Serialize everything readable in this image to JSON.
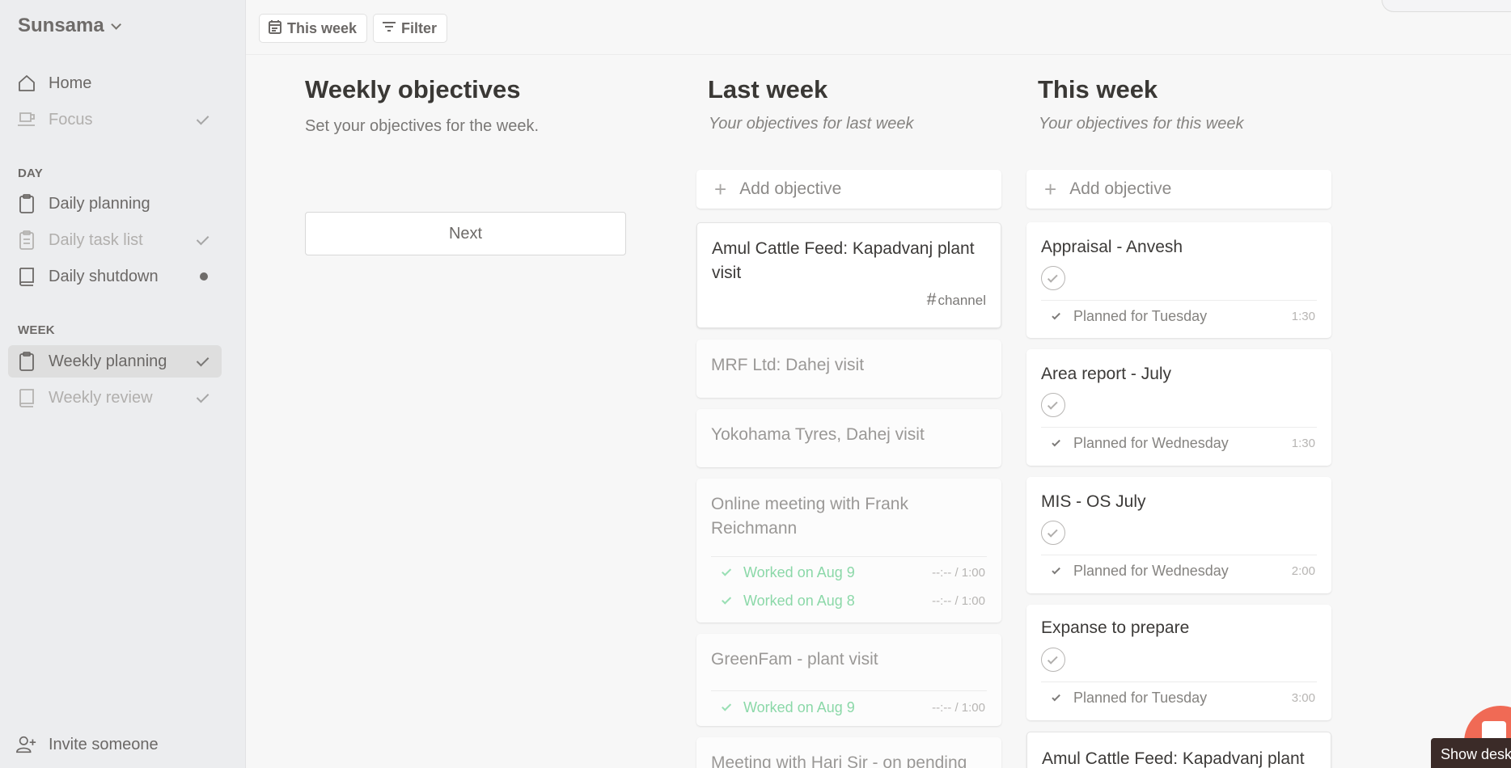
{
  "sidebar": {
    "brand": "Sunsama",
    "items_top": [
      {
        "label": "Home",
        "icon": "home-icon",
        "state": "none"
      },
      {
        "label": "Focus",
        "icon": "coffee-cup-icon",
        "state": "done"
      }
    ],
    "day_section": "DAY",
    "day_items": [
      {
        "label": "Daily planning",
        "icon": "clipboard-icon",
        "state": "none"
      },
      {
        "label": "Daily task list",
        "icon": "clipboard-list-icon",
        "state": "done"
      },
      {
        "label": "Daily shutdown",
        "icon": "book-icon",
        "state": "pending"
      }
    ],
    "week_section": "WEEK",
    "week_items": [
      {
        "label": "Weekly planning",
        "icon": "clipboard-icon",
        "state": "done",
        "active": true
      },
      {
        "label": "Weekly review",
        "icon": "book-icon",
        "state": "done"
      }
    ],
    "invite": "Invite someone"
  },
  "toolbar": {
    "this_week": "This week",
    "filter": "Filter"
  },
  "objectives": {
    "title": "Weekly objectives",
    "subtitle": "Set your objectives for the week.",
    "next": "Next"
  },
  "last_week": {
    "title": "Last week",
    "subtitle": "Your objectives for last week",
    "add": "Add objective",
    "cards": [
      {
        "title": "Amul Cattle Feed: Kapadvanj plant visit",
        "channel": "channel"
      },
      {
        "title": "MRF Ltd: Dahej visit"
      },
      {
        "title": "Yokohama Tyres, Dahej visit"
      },
      {
        "title": "Online meeting with Frank Reichmann",
        "rows": [
          {
            "text": "Worked on Aug 9",
            "time": "--:-- / 1:00"
          },
          {
            "text": "Worked on Aug 8",
            "time": "--:-- / 1:00"
          }
        ]
      },
      {
        "title": "GreenFam - plant visit",
        "rows": [
          {
            "text": "Worked on Aug 9",
            "time": "--:-- / 1:00"
          }
        ]
      },
      {
        "title": "Meeting with Hari Sir - on pending"
      }
    ]
  },
  "this_week": {
    "title": "This week",
    "subtitle": "Your objectives for this week",
    "add": "Add objective",
    "cards": [
      {
        "title": "Appraisal - Anvesh",
        "planned": "Planned for Tuesday",
        "time": "1:30"
      },
      {
        "title": "Area report - July",
        "planned": "Planned for Wednesday",
        "time": "1:30"
      },
      {
        "title": "MIS - OS July",
        "planned": "Planned for Wednesday",
        "time": "2:00"
      },
      {
        "title": "Expanse to prepare",
        "planned": "Planned for Tuesday",
        "time": "3:00"
      },
      {
        "title": "Amul Cattle Feed: Kapadvanj plant"
      }
    ]
  },
  "tooltip": "Show desktop",
  "colors": {
    "accent": "#f06a55",
    "worked_green": "#8bd8a8"
  }
}
